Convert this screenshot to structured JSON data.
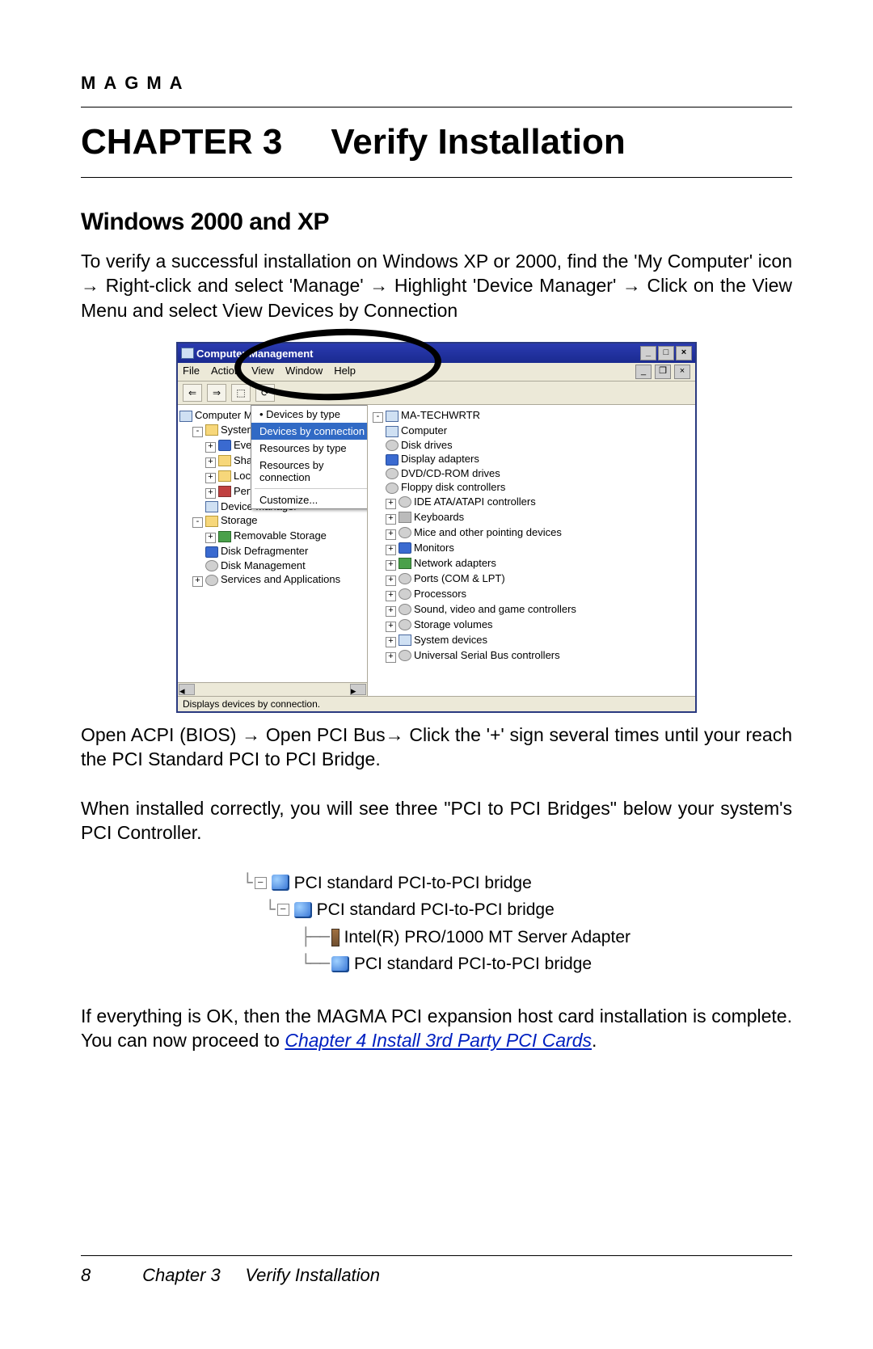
{
  "brand": "MAGMA",
  "chapter": {
    "label": "CHAPTER 3",
    "title": "Verify Installation"
  },
  "section1": "Windows 2000 and XP",
  "para1": "To verify a successful installation on Windows XP or 2000, find the 'My Computer' icon → Right-click and select 'Manage' → Highlight 'Device Manager' → Click on the View Menu and select View Devices by Connection",
  "cm": {
    "title": "Computer Management",
    "menus": [
      "File",
      "Action",
      "View",
      "Window",
      "Help"
    ],
    "view_menu": {
      "items": [
        "Devices by type",
        "Devices by connection",
        "Resources by type",
        "Resources by connection"
      ],
      "selected_index": 1,
      "customize": "Customize..."
    },
    "left_tree": {
      "root": "Computer Management",
      "system_tools": "System Tools",
      "event": "Event Viewer",
      "shared": "Shared Folders",
      "local": "Local Users",
      "perf": "Performance",
      "devmgr": "Device Manager",
      "storage": "Storage",
      "removable": "Removable Storage",
      "defrag": "Disk Defragmenter",
      "diskmgmt": "Disk Management",
      "services": "Services and Applications"
    },
    "right_tree": {
      "host": "MA-TECHWRTR",
      "items": [
        "Computer",
        "Disk drives",
        "Display adapters",
        "DVD/CD-ROM drives",
        "Floppy disk controllers",
        "IDE ATA/ATAPI controllers",
        "Keyboards",
        "Mice and other pointing devices",
        "Monitors",
        "Network adapters",
        "Ports (COM & LPT)",
        "Processors",
        "Sound, video and game controllers",
        "Storage volumes",
        "System devices",
        "Universal Serial Bus controllers"
      ]
    },
    "status": "Displays devices by connection."
  },
  "para2": "Open ACPI (BIOS) → Open PCI Bus→ Click the '+' sign several times until your reach the PCI Standard PCI to PCI Bridge.",
  "para3": "When installed correctly, you will see three \"PCI to PCI Bridges\" below your system's PCI Controller.",
  "tree2": {
    "n1": "PCI standard PCI-to-PCI bridge",
    "n2": "PCI standard PCI-to-PCI bridge",
    "n3": "Intel(R) PRO/1000 MT Server Adapter",
    "n4": "PCI standard PCI-to-PCI bridge"
  },
  "para4a": "If everything is OK, then the MAGMA PCI expansion host card installation is complete. You can now proceed to ",
  "link": "Chapter 4 Install 3rd Party PCI Cards",
  "para4b": ".",
  "footer": {
    "page": "8",
    "chapter": "Chapter 3",
    "title": "Verify Installation"
  }
}
